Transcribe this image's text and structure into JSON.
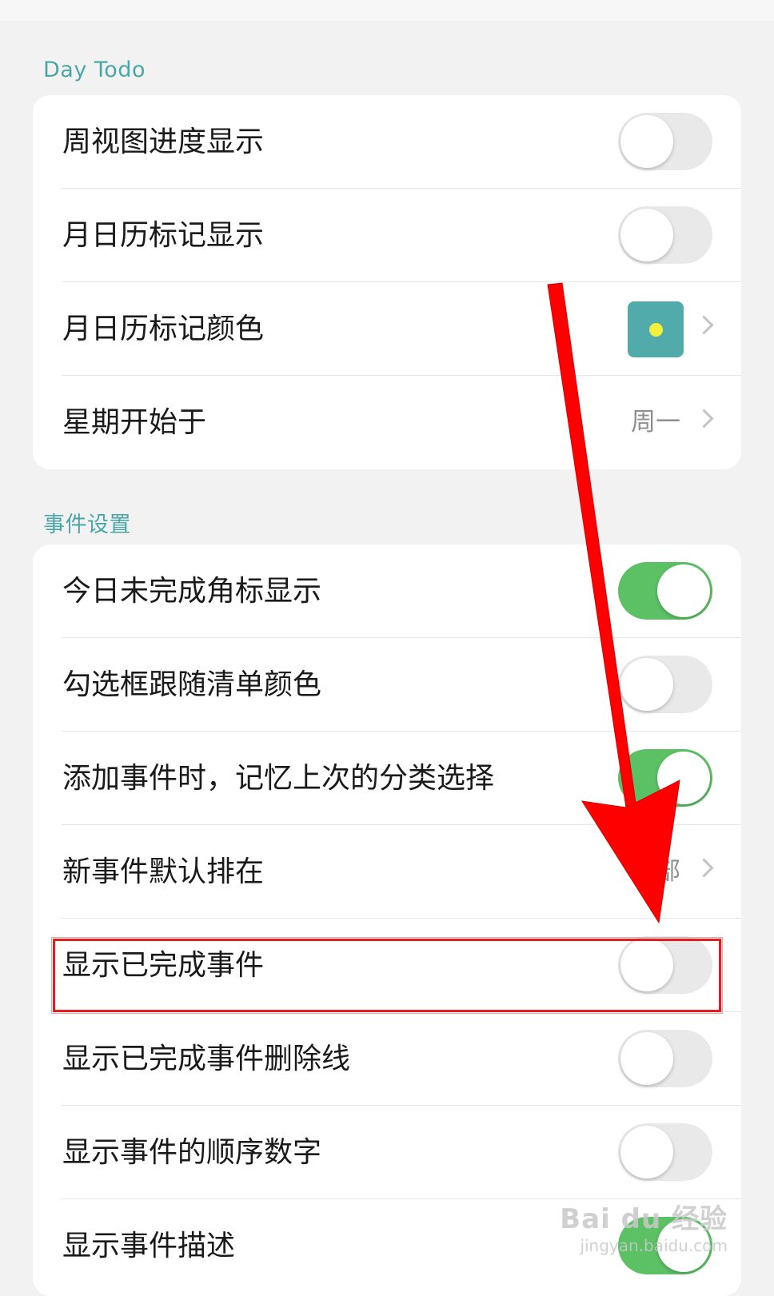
{
  "sections": [
    {
      "title": "Day Todo",
      "rows": [
        {
          "label": "周视图进度显示",
          "type": "toggle",
          "on": false
        },
        {
          "label": "月日历标记显示",
          "type": "toggle",
          "on": false
        },
        {
          "label": "月日历标记颜色",
          "type": "color",
          "color": "#52abab",
          "dot_color": "#f3ef3a"
        },
        {
          "label": "星期开始于",
          "type": "value",
          "value": "周一"
        }
      ]
    },
    {
      "title": "事件设置",
      "rows": [
        {
          "label": "今日未完成角标显示",
          "type": "toggle",
          "on": true
        },
        {
          "label": "勾选框跟随清单颜色",
          "type": "toggle",
          "on": false
        },
        {
          "label": "添加事件时，记忆上次的分类选择",
          "type": "toggle",
          "on": true
        },
        {
          "label": "新事件默认排在",
          "type": "value",
          "value": "底部"
        },
        {
          "label": "显示已完成事件",
          "type": "toggle",
          "on": false
        },
        {
          "label": "显示已完成事件删除线",
          "type": "toggle",
          "on": false
        },
        {
          "label": "显示事件的顺序数字",
          "type": "toggle",
          "on": false
        },
        {
          "label": "显示事件描述",
          "type": "toggle",
          "on": true
        }
      ]
    }
  ],
  "watermark": {
    "main": "Bai du 经验",
    "sub": "jingyan.baidu.com"
  },
  "colors": {
    "accent": "#4aa7a8",
    "toggle_on": "#5cc065",
    "annotation": "#e21d1d"
  }
}
